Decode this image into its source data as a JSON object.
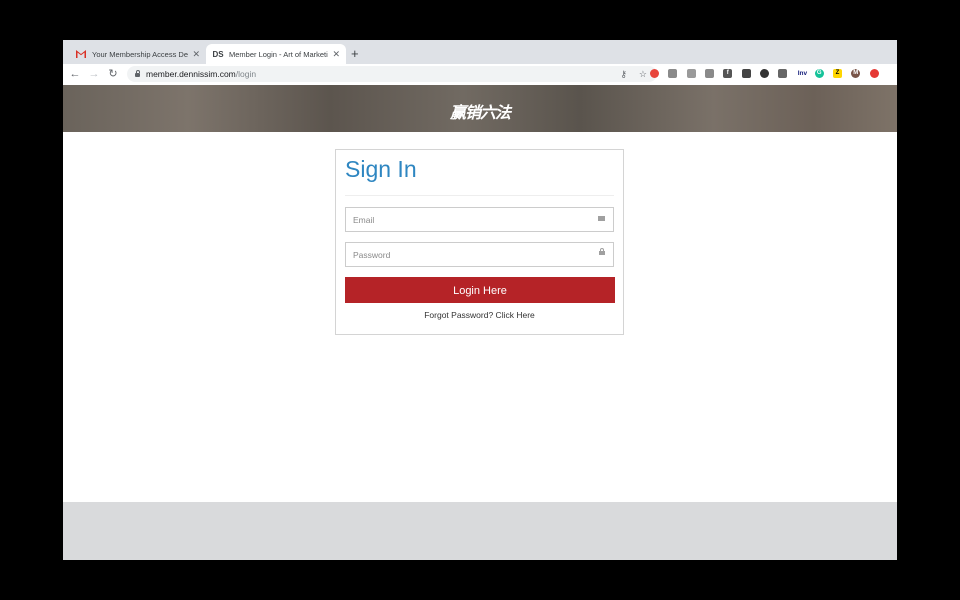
{
  "browser": {
    "tabs": [
      {
        "title": "Your Membership Access Details",
        "favicon": "gmail-icon",
        "active": false
      },
      {
        "title": "Member Login - Art of Marketing",
        "favicon": "ds-icon",
        "favicon_text": "DS",
        "active": true
      }
    ],
    "new_tab_glyph": "+",
    "close_glyph": "✕",
    "url_host": "member.dennissim.com",
    "url_path": "/login",
    "extensions": [
      {
        "name": "extension-1-icon",
        "color": "#e8453c",
        "text": ""
      },
      {
        "name": "camera-extension-icon",
        "color": "#8a8a8a",
        "text": ""
      },
      {
        "name": "code-extension-icon",
        "color": "#9a9a9a",
        "text": ""
      },
      {
        "name": "extension-4-icon",
        "color": "#8a8a8a",
        "text": ""
      },
      {
        "name": "facebook-extension-icon",
        "color": "#555555",
        "text": "f"
      },
      {
        "name": "extension-6-icon",
        "color": "#444444",
        "text": ""
      },
      {
        "name": "extension-7-icon",
        "color": "#333333",
        "text": ""
      },
      {
        "name": "pen-extension-icon",
        "color": "#666666",
        "text": ""
      },
      {
        "name": "inv-extension-icon",
        "color": "#ffffff",
        "text": "Inv"
      },
      {
        "name": "grammarly-extension-icon",
        "color": "#15c39a",
        "text": "G"
      },
      {
        "name": "z-extension-icon",
        "color": "#ffd600",
        "text": "Z"
      },
      {
        "name": "profile-avatar",
        "color": "#795548",
        "text": "M"
      },
      {
        "name": "update-extension-icon",
        "color": "#e53935",
        "text": ""
      }
    ]
  },
  "banner": {
    "logo_text": "赢销六法"
  },
  "login": {
    "title": "Sign In",
    "email_placeholder": "Email",
    "password_placeholder": "Password",
    "login_button": "Login Here",
    "forgot_link": "Forgot Password? Click Here"
  },
  "colors": {
    "title_blue": "#2e86c1",
    "button_red": "#b52327",
    "footer_gray": "#d9dadc"
  }
}
